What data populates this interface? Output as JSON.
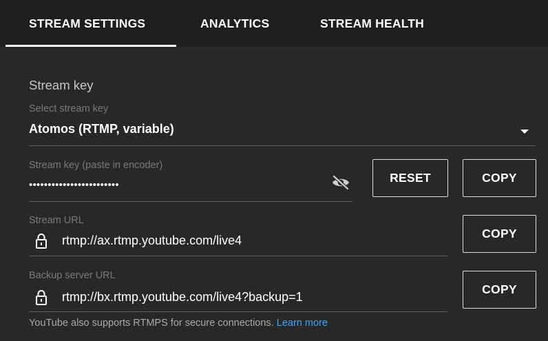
{
  "tabs": [
    {
      "label": "STREAM SETTINGS",
      "active": true
    },
    {
      "label": "ANALYTICS",
      "active": false
    },
    {
      "label": "STREAM HEALTH",
      "active": false
    }
  ],
  "stream_key_section": {
    "title": "Stream key",
    "select_label": "Select stream key",
    "selected_value": "Atomos (RTMP, variable)",
    "key_label": "Stream key (paste in encoder)",
    "key_value_masked": "••••••••••••••••••••••••",
    "reset_label": "RESET",
    "copy_label": "COPY"
  },
  "stream_url": {
    "label": "Stream URL",
    "value": "rtmp://ax.rtmp.youtube.com/live4",
    "copy_label": "COPY"
  },
  "backup_url": {
    "label": "Backup server URL",
    "value": "rtmp://bx.rtmp.youtube.com/live4?backup=1",
    "copy_label": "COPY"
  },
  "footer": {
    "text": "YouTube also supports RTMPS for secure connections.",
    "link": "Learn more"
  },
  "icons": {
    "dropdown": "caret-down-icon",
    "visibility": "eye-off-icon",
    "lock": "lock-icon"
  },
  "colors": {
    "background": "#282828",
    "tab_bar": "#1f1f1f",
    "link": "#3ea6ff",
    "label": "#7a7a7a",
    "underline": "#5f5f5f"
  }
}
